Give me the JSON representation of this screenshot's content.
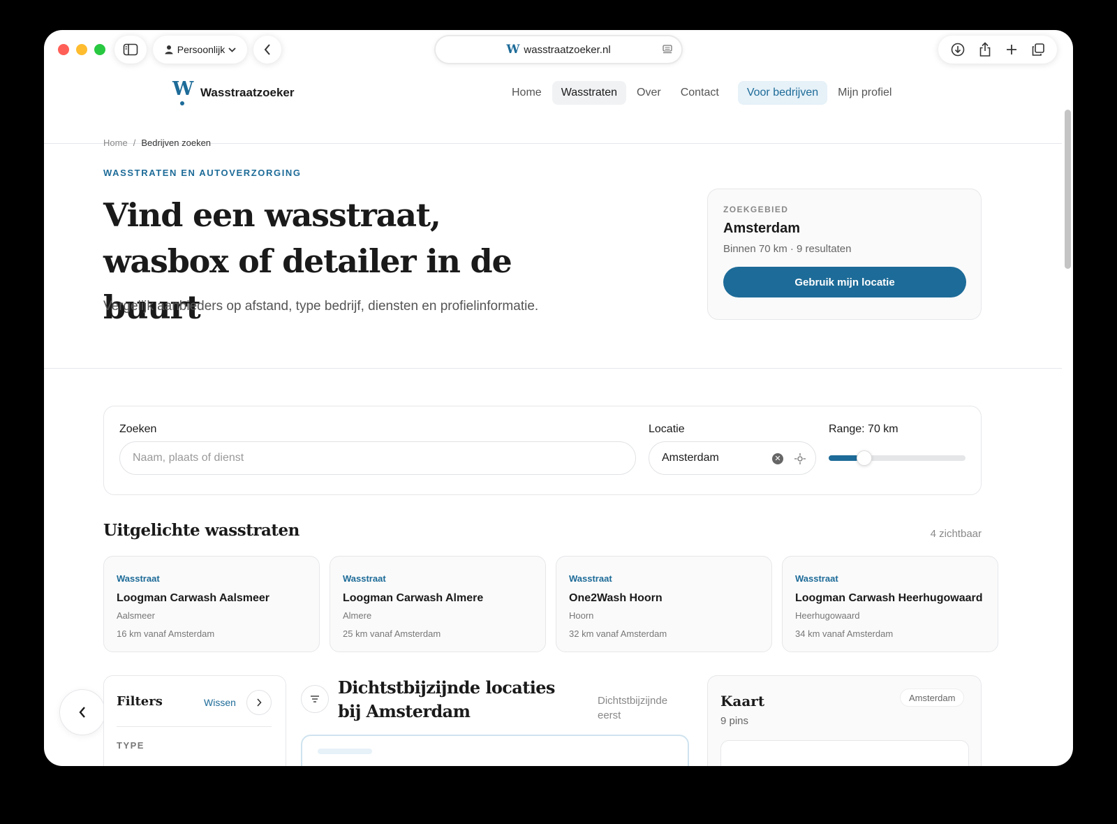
{
  "browser": {
    "profile_label": "Persoonlijk",
    "url": "wasstraatzoeker.nl",
    "favicon_letter": "W"
  },
  "site": {
    "logo_letter": "W",
    "name": "Wasstraatzoeker",
    "nav": [
      {
        "label": "Home"
      },
      {
        "label": "Wasstraten"
      },
      {
        "label": "Over"
      },
      {
        "label": "Contact"
      },
      {
        "label": "Voor bedrijven"
      },
      {
        "label": "Mijn profiel"
      }
    ]
  },
  "breadcrumb": {
    "home": "Home",
    "separator": "/",
    "current": "Bedrijven zoeken"
  },
  "hero": {
    "eyebrow": "WASSTRATEN EN AUTOVERZORGING",
    "title": "Vind een wasstraat, wasbox of detailer in de buurt",
    "subtitle": "Vergelijk aanbieders op afstand, type bedrijf, diensten en profielinformatie."
  },
  "search_area": {
    "label": "ZOEKGEBIED",
    "city": "Amsterdam",
    "info": "Binnen 70 km · 9 resultaten",
    "button": "Gebruik mijn locatie"
  },
  "search": {
    "query_label": "Zoeken",
    "query_placeholder": "Naam, plaats of dienst",
    "location_label": "Locatie",
    "location_value": "Amsterdam",
    "range_label": "Range: 70 km",
    "range_fraction": 0.2
  },
  "featured": {
    "title": "Uitgelichte wasstraten",
    "count": "4 zichtbaar",
    "items": [
      {
        "type": "Wasstraat",
        "name": "Loogman Carwash Aalsmeer",
        "city": "Aalsmeer",
        "distance": "16 km vanaf Amsterdam"
      },
      {
        "type": "Wasstraat",
        "name": "Loogman Carwash Almere",
        "city": "Almere",
        "distance": "25 km vanaf Amsterdam"
      },
      {
        "type": "Wasstraat",
        "name": "One2Wash Hoorn",
        "city": "Hoorn",
        "distance": "32 km vanaf Amsterdam"
      },
      {
        "type": "Wasstraat",
        "name": "Loogman Carwash Heerhugowaard",
        "city": "Heerhugowaard",
        "distance": "34 km vanaf Amsterdam"
      }
    ]
  },
  "filters": {
    "title": "Filters",
    "clear": "Wissen",
    "type_label": "TYPE"
  },
  "list": {
    "title": "Dichtstbijzijnde locaties bij Amsterdam",
    "sort": "Dichtstbijzijnde eerst"
  },
  "map": {
    "title": "Kaart",
    "pins": "9 pins",
    "badge": "Amsterdam"
  },
  "colors": {
    "accent": "#1d6b98",
    "close": "#ff5f57",
    "minimize": "#febc2e",
    "zoom": "#28c840"
  }
}
